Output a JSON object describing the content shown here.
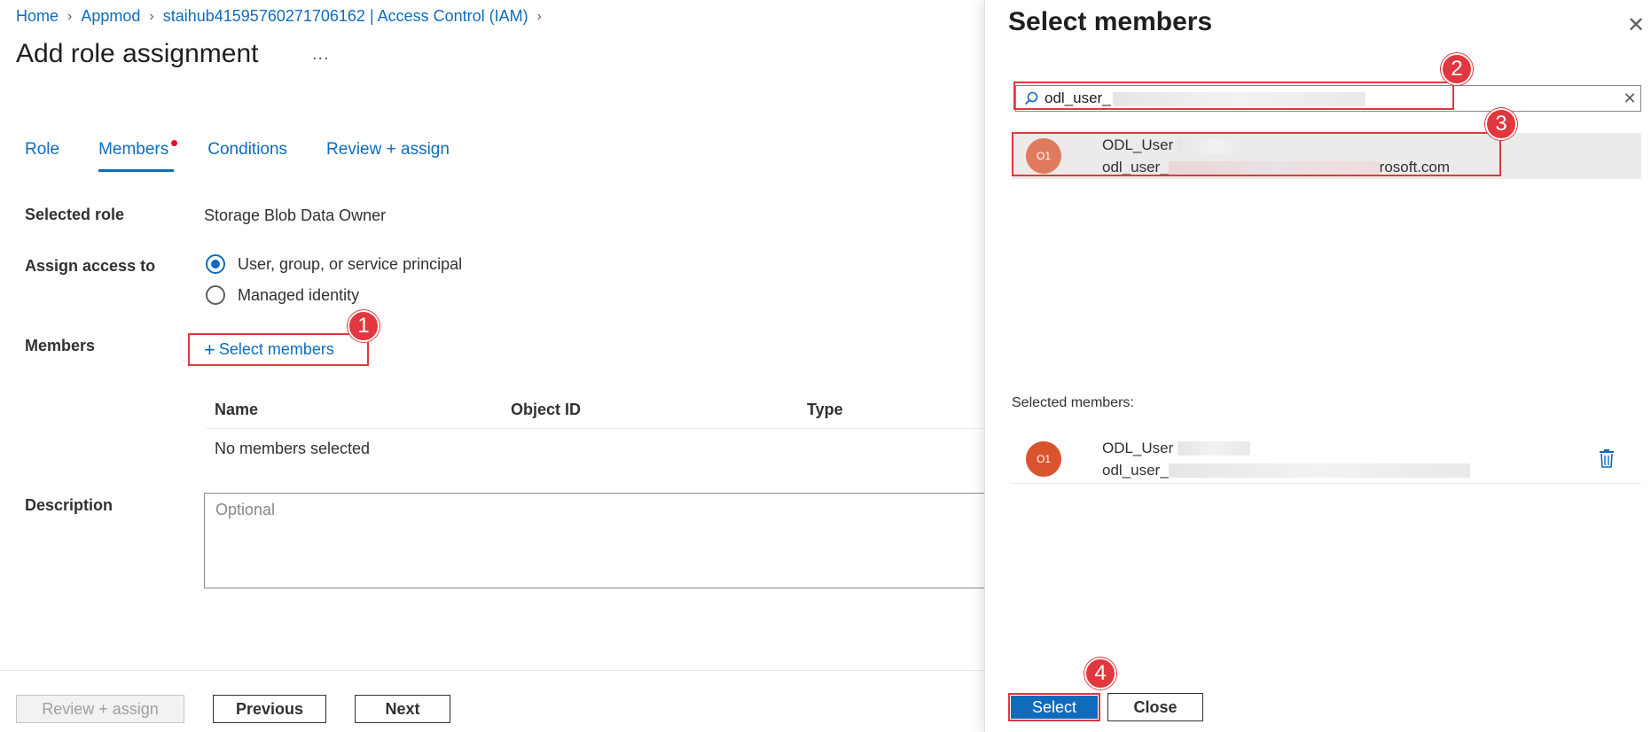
{
  "breadcrumb": {
    "items": [
      "Home",
      "Appmod",
      "staihub41595760271706162 | Access Control (IAM)"
    ]
  },
  "page": {
    "title": "Add role assignment",
    "more": "..."
  },
  "tabs": [
    {
      "label": "Role"
    },
    {
      "label": "Members",
      "active": true
    },
    {
      "label": "Conditions"
    },
    {
      "label": "Review + assign"
    }
  ],
  "form": {
    "selected_role_label": "Selected role",
    "selected_role_value": "Storage Blob Data Owner",
    "assign_access_label": "Assign access to",
    "assign_options": [
      "User, group, or service principal",
      "Managed identity"
    ],
    "members_label": "Members",
    "select_members_link": "Select members",
    "description_label": "Description",
    "description_placeholder": "Optional"
  },
  "members_table": {
    "columns": [
      "Name",
      "Object ID",
      "Type"
    ],
    "empty_text": "No members selected"
  },
  "footer": {
    "review_assign": "Review + assign",
    "previous": "Previous",
    "next": "Next"
  },
  "annotations": [
    "1",
    "2",
    "3",
    "4"
  ],
  "panel": {
    "title": "Select members",
    "search_value": "odl_user_",
    "result": {
      "initials": "O1",
      "name": "ODL_User",
      "email_start": "odl_user_",
      "email_end": "rosoft.com"
    },
    "selected_members_label": "Selected members:",
    "selected": {
      "initials": "O1",
      "name": "ODL_User",
      "email_start": "odl_user_"
    },
    "select_button": "Select",
    "close_button": "Close"
  },
  "colors": {
    "accent": "#0f6cbd",
    "annotation": "#e0383e",
    "avatar_peach": "#e07a5f",
    "avatar_red": "#d9532e"
  }
}
